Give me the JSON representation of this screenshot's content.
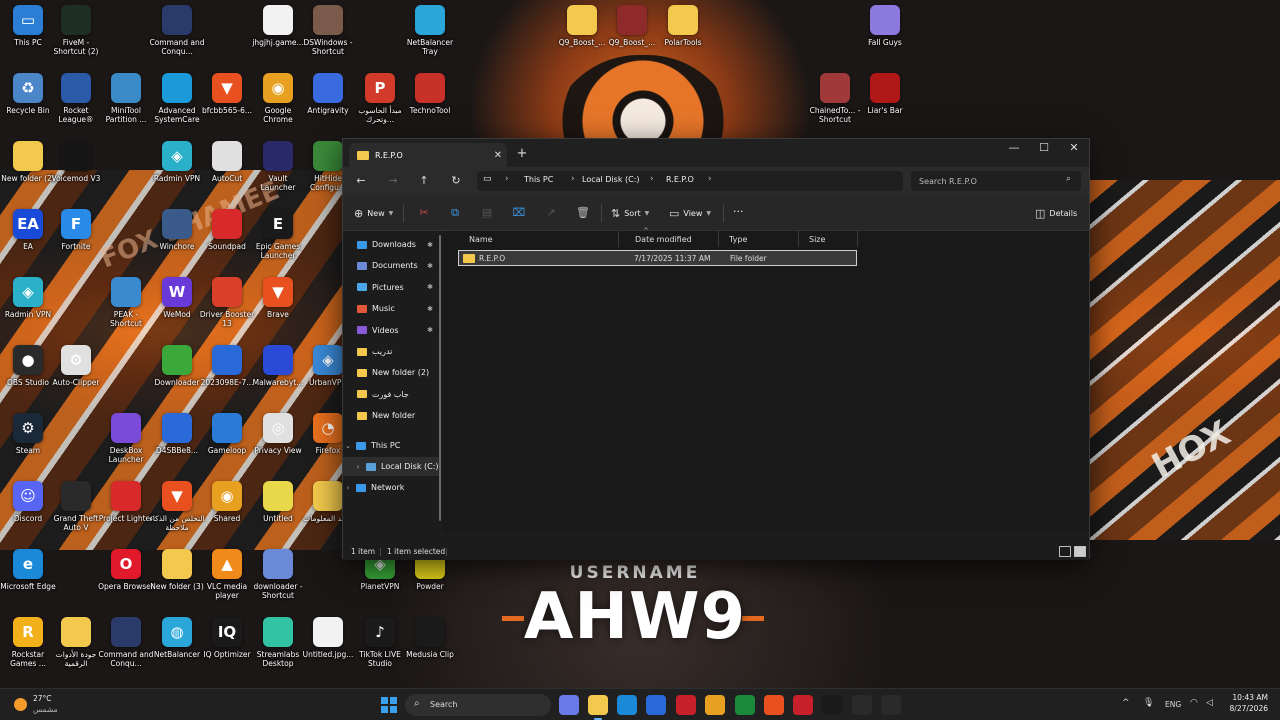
{
  "desktop": {
    "background_text": {
      "username_label": "USERNAME",
      "username_value": "AHW9",
      "brand_right": "HOX",
      "brand_left": "FOX SHAMEE"
    },
    "icons": [
      {
        "label": "This PC",
        "icon": "computer-icon",
        "color": "#2a7fd4"
      },
      {
        "label": "FiveM - Shortcut (2)",
        "icon": "fivem-icon",
        "color": "#1f2f24"
      },
      {
        "label": "Command and Conqu...",
        "icon": "game-emblem-icon",
        "color": "#2a3a6a"
      },
      {
        "label": "jhgjhj.game...",
        "icon": "file-icon",
        "color": "#f2f2f2"
      },
      {
        "label": "DSWindows - Shortcut",
        "icon": "app-icon",
        "color": "#7a5a4a"
      },
      {
        "label": "NetBalancer Tray",
        "icon": "chart-icon",
        "color": "#2aa7d8"
      },
      {
        "label": "Q9_Boost_...",
        "icon": "folder-icon",
        "color": "#f2c94c"
      },
      {
        "label": "Q9_Boost_...",
        "icon": "archive-icon",
        "color": "#8e2a2a"
      },
      {
        "label": "PolarTools",
        "icon": "folder-icon",
        "color": "#f2c94c"
      },
      {
        "label": "Fall Guys",
        "icon": "game-icon",
        "color": "#8a7ae0"
      },
      {
        "label": "Recycle Bin",
        "icon": "recycle-bin-icon",
        "color": "#4a86c8"
      },
      {
        "label": "Rocket League®",
        "icon": "rocket-league-icon",
        "color": "#2a5aa8"
      },
      {
        "label": "MiniTool Partition ...",
        "icon": "partition-icon",
        "color": "#3a8ac8"
      },
      {
        "label": "Advanced SystemCare",
        "icon": "systemcare-icon",
        "color": "#1a9ad8"
      },
      {
        "label": "bfcbb565-6...",
        "icon": "brave-icon",
        "color": "#e8501f"
      },
      {
        "label": "Google Chrome",
        "icon": "chrome-icon",
        "color": "#e8a020"
      },
      {
        "label": "Antigravity",
        "icon": "antigravity-icon",
        "color": "#3a6ae0"
      },
      {
        "label": "مبدأ الحاسوب وتحرك...",
        "icon": "pdf-icon",
        "color": "#d23a2a"
      },
      {
        "label": "TechnoTool",
        "icon": "steam-like-icon",
        "color": "#c8302a"
      },
      {
        "label": "ChainedTo... - Shortcut",
        "icon": "game-icon",
        "color": "#a03a3a"
      },
      {
        "label": "Liar's Bar",
        "icon": "game-icon",
        "color": "#b01818"
      },
      {
        "label": "New folder (2)",
        "icon": "folder-icon",
        "color": "#f2c94c"
      },
      {
        "label": "Voicemod V3",
        "icon": "voicemod-icon",
        "color": "#151515"
      },
      {
        "label": "Radmin VPN",
        "icon": "vpn-icon",
        "color": "#2ab0c8"
      },
      {
        "label": "AutoCut",
        "icon": "autocut-icon",
        "color": "#e0e0e0"
      },
      {
        "label": "Vault Launcher",
        "icon": "vault-icon",
        "color": "#2a2a6a"
      },
      {
        "label": "HitHide Configu...",
        "icon": "app-icon",
        "color": "#3a8a3a"
      },
      {
        "label": "EA",
        "icon": "ea-icon",
        "color": "#1a4ad8"
      },
      {
        "label": "Fortnite",
        "icon": "fortnite-icon",
        "color": "#2a8ae8"
      },
      {
        "label": "Winchore",
        "icon": "app-icon",
        "color": "#3a5a8a"
      },
      {
        "label": "Soundpad",
        "icon": "soundpad-icon",
        "color": "#d82a2a"
      },
      {
        "label": "Epic Games Launcher",
        "icon": "epic-icon",
        "color": "#1a1a1a"
      },
      {
        "label": "Radmin VPN",
        "icon": "vpn-icon",
        "color": "#2ab0c8"
      },
      {
        "label": "PEAK - Shortcut",
        "icon": "mountain-icon",
        "color": "#3a8ad0"
      },
      {
        "label": "WeMod",
        "icon": "wemod-icon",
        "color": "#6a3ad8"
      },
      {
        "label": "Driver Booster 13",
        "icon": "driver-booster-icon",
        "color": "#d8402a"
      },
      {
        "label": "Brave",
        "icon": "brave-icon",
        "color": "#e8501f"
      },
      {
        "label": "OBS Studio",
        "icon": "obs-icon",
        "color": "#2a2a2a"
      },
      {
        "label": "Auto-Clipper",
        "icon": "gear-icon",
        "color": "#e0e0e0"
      },
      {
        "label": "Downloader",
        "icon": "downloader-icon",
        "color": "#3aa83a"
      },
      {
        "label": "2023098E-7...",
        "icon": "image-file-icon",
        "color": "#2a6ad8"
      },
      {
        "label": "Malwarebyt...",
        "icon": "malwarebytes-icon",
        "color": "#2a4ad8"
      },
      {
        "label": "UrbanVPN",
        "icon": "vpn-icon",
        "color": "#3a8ad8"
      },
      {
        "label": "Steam",
        "icon": "steam-icon",
        "color": "#1b2838"
      },
      {
        "label": "DeskBox Launcher",
        "icon": "box-icon",
        "color": "#7a4ad8"
      },
      {
        "label": "D4SBBe8...",
        "icon": "image-file-icon",
        "color": "#2a6ad8"
      },
      {
        "label": "Gameloop",
        "icon": "gameloop-icon",
        "color": "#2a7ad8"
      },
      {
        "label": "Privacy View",
        "icon": "eye-icon",
        "color": "#e0e0e0"
      },
      {
        "label": "Firefox",
        "icon": "firefox-icon",
        "color": "#e8701f"
      },
      {
        "label": "Discord",
        "icon": "discord-icon",
        "color": "#5865f2"
      },
      {
        "label": "Grand Theft Auto V",
        "icon": "gta-icon",
        "color": "#2a2a2a"
      },
      {
        "label": "Project Lighter",
        "icon": "app-icon",
        "color": "#d82a2a"
      },
      {
        "label": "التخلص من الذكاء ملاحظة",
        "icon": "brave-icon",
        "color": "#e8501f"
      },
      {
        "label": "Shared",
        "icon": "chrome-icon",
        "color": "#e8a020"
      },
      {
        "label": "Untitled",
        "icon": "code-file-icon",
        "color": "#e8d84a"
      },
      {
        "label": "مجلد المعلومات",
        "icon": "folder-icon",
        "color": "#f2c94c"
      },
      {
        "label": "Microsoft Edge",
        "icon": "edge-icon",
        "color": "#1a8ad8"
      },
      {
        "label": "Opera Browser",
        "icon": "opera-icon",
        "color": "#e01a2a"
      },
      {
        "label": "New folder (3)",
        "icon": "folder-icon",
        "color": "#f2c94c"
      },
      {
        "label": "VLC media player",
        "icon": "vlc-icon",
        "color": "#f08a1a"
      },
      {
        "label": "downloader - Shortcut",
        "icon": "app-icon",
        "color": "#6a8ad8"
      },
      {
        "label": "PlanetVPN",
        "icon": "vpn-icon",
        "color": "#3aa83a"
      },
      {
        "label": "Powder",
        "icon": "powder-icon",
        "color": "#e8d81a"
      },
      {
        "label": "Rockstar Games ...",
        "icon": "rockstar-icon",
        "color": "#f2b01a"
      },
      {
        "label": "جودة الأدوات الرقمية",
        "icon": "folder-icon",
        "color": "#f2c94c"
      },
      {
        "label": "Command and Conqu...",
        "icon": "game-emblem-icon",
        "color": "#2a3a6a"
      },
      {
        "label": "NetBalancer",
        "icon": "globe-icon",
        "color": "#2aa7d8"
      },
      {
        "label": "IQ Optimizer",
        "icon": "iq-icon",
        "color": "#1a1a1a"
      },
      {
        "label": "Streamlabs Desktop",
        "icon": "streamlabs-icon",
        "color": "#31c3a2"
      },
      {
        "label": "Untitled.jpg...",
        "icon": "file-icon",
        "color": "#f2f2f2"
      },
      {
        "label": "TikTok LIVE Studio",
        "icon": "tiktok-icon",
        "color": "#1a1a1a"
      },
      {
        "label": "Medusia Clip",
        "icon": "app-icon",
        "color": "#1a1a1a"
      }
    ]
  },
  "explorer": {
    "tab_title": "R.E.P.O",
    "window_controls": {
      "minimize": "—",
      "maximize": "☐",
      "close": "✕"
    },
    "breadcrumb": [
      "This PC",
      "Local Disk (C:)",
      "R.E.P.O"
    ],
    "search_placeholder": "Search R.E.P.O",
    "commands": {
      "new": "New",
      "sort": "Sort",
      "view": "View",
      "more": "···",
      "details": "Details"
    },
    "nav": {
      "quick_access": [
        {
          "label": "Downloads",
          "icon": "download-icon",
          "color": "#3a9ae8"
        },
        {
          "label": "Documents",
          "icon": "document-icon",
          "color": "#6a8ad8"
        },
        {
          "label": "Pictures",
          "icon": "pictures-icon",
          "color": "#4aa8e8"
        },
        {
          "label": "Music",
          "icon": "music-icon",
          "color": "#e05a3a"
        },
        {
          "label": "Videos",
          "icon": "video-icon",
          "color": "#8a5ad8"
        },
        {
          "label": "تدريب",
          "icon": "folder-icon",
          "color": "#f2c94c"
        },
        {
          "label": "New folder (2)",
          "icon": "folder-icon",
          "color": "#f2c94c"
        },
        {
          "label": "جاب فورت",
          "icon": "folder-icon",
          "color": "#f2c94c"
        },
        {
          "label": "New folder",
          "icon": "folder-icon",
          "color": "#f2c94c"
        }
      ],
      "this_pc": "This PC",
      "local_disk": "Local Disk (C:)",
      "network": "Network"
    },
    "columns": [
      "Name",
      "Date modified",
      "Type",
      "Size"
    ],
    "rows": [
      {
        "name": "R.E.P.O",
        "date_modified": "7/17/2025 11:37 AM",
        "type": "File folder",
        "size": ""
      }
    ],
    "status": {
      "count": "1 item",
      "selected": "1 item selected"
    }
  },
  "taskbar": {
    "weather_temp": "27°C",
    "weather_condition": "مشمس",
    "search_label": "Search",
    "apps": [
      {
        "name": "copilot-icon",
        "color": "#6a7ae8"
      },
      {
        "name": "file-explorer-icon",
        "color": "#f2c94c",
        "active": true
      },
      {
        "name": "edge-icon",
        "color": "#1a8ad8"
      },
      {
        "name": "store-icon",
        "color": "#2a6ad8"
      },
      {
        "name": "app-icon",
        "color": "#c8202a"
      },
      {
        "name": "chrome-icon",
        "color": "#e8a020"
      },
      {
        "name": "xbox-icon",
        "color": "#1a8a3a"
      },
      {
        "name": "brave-icon",
        "color": "#e8501f"
      },
      {
        "name": "record-icon",
        "color": "#c8202a"
      },
      {
        "name": "terminal-icon",
        "color": "#1a1a1a"
      },
      {
        "name": "obs-icon",
        "color": "#2a2a2a"
      },
      {
        "name": "epic-icon",
        "color": "#2a2a2a"
      }
    ],
    "lang": "ENG",
    "time": "10:43 AM",
    "date": "8/27/2026"
  }
}
